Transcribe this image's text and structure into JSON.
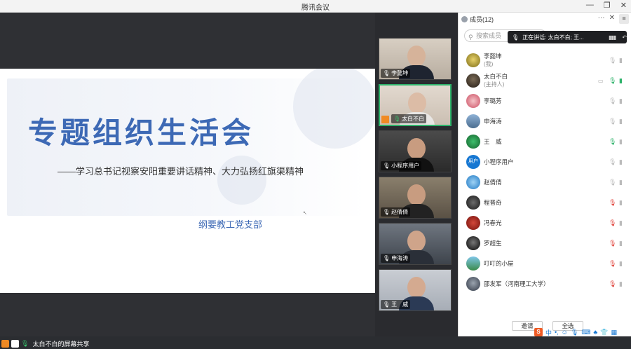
{
  "window": {
    "title": "腾讯会议",
    "minimize": "—",
    "maximize": "❐",
    "close": "✕"
  },
  "slide": {
    "title": "专题组织生活会",
    "subtitle": "——学习总书记视察安阳重要讲话精神、大力弘扬红旗渠精神",
    "organization": "纲要教工党支部"
  },
  "share_bar": {
    "text": "太白不白的屏幕共享"
  },
  "video_tiles": [
    {
      "name": "李懿坤",
      "active": false
    },
    {
      "name": "太白不白",
      "active": true,
      "host": true
    },
    {
      "name": "小程序用户",
      "active": false
    },
    {
      "name": "赵倩倩",
      "active": false
    },
    {
      "name": "申海涛",
      "active": false
    },
    {
      "name": "王　威",
      "active": false
    }
  ],
  "panel": {
    "title": "成员(12)",
    "more": "···",
    "close": "✕",
    "menu": "≡",
    "search_placeholder": "搜索成员",
    "speaking": "正在讲话: 太白不白; 王...",
    "members": [
      {
        "name": "李懿坤",
        "role": "(我)",
        "mic": "off"
      },
      {
        "name": "太白不白",
        "role": "(主持人)",
        "mic": "on"
      },
      {
        "name": "李璐芳",
        "role": "",
        "mic": "off"
      },
      {
        "name": "申海涛",
        "role": "",
        "mic": "off"
      },
      {
        "name": "王　威",
        "role": "",
        "mic": "on"
      },
      {
        "name": "小程序用户",
        "role": "",
        "mic": "off",
        "avatar_text": "用户"
      },
      {
        "name": "赵倩倩",
        "role": "",
        "mic": "off"
      },
      {
        "name": "程晋奇",
        "role": "",
        "mic": "muted"
      },
      {
        "name": "冯春光",
        "role": "",
        "mic": "muted"
      },
      {
        "name": "罗超生",
        "role": "",
        "mic": "muted"
      },
      {
        "name": "叮叮的小屋",
        "role": "",
        "mic": "muted"
      },
      {
        "name": "邵发军（河南理工大学）",
        "role": "",
        "mic": "muted"
      }
    ],
    "invite_label": "邀请",
    "all_label": "全选"
  },
  "colors": {
    "accent_blue": "#3d69b5",
    "active_green": "#2fb36b",
    "muted_red": "#e0443c"
  }
}
